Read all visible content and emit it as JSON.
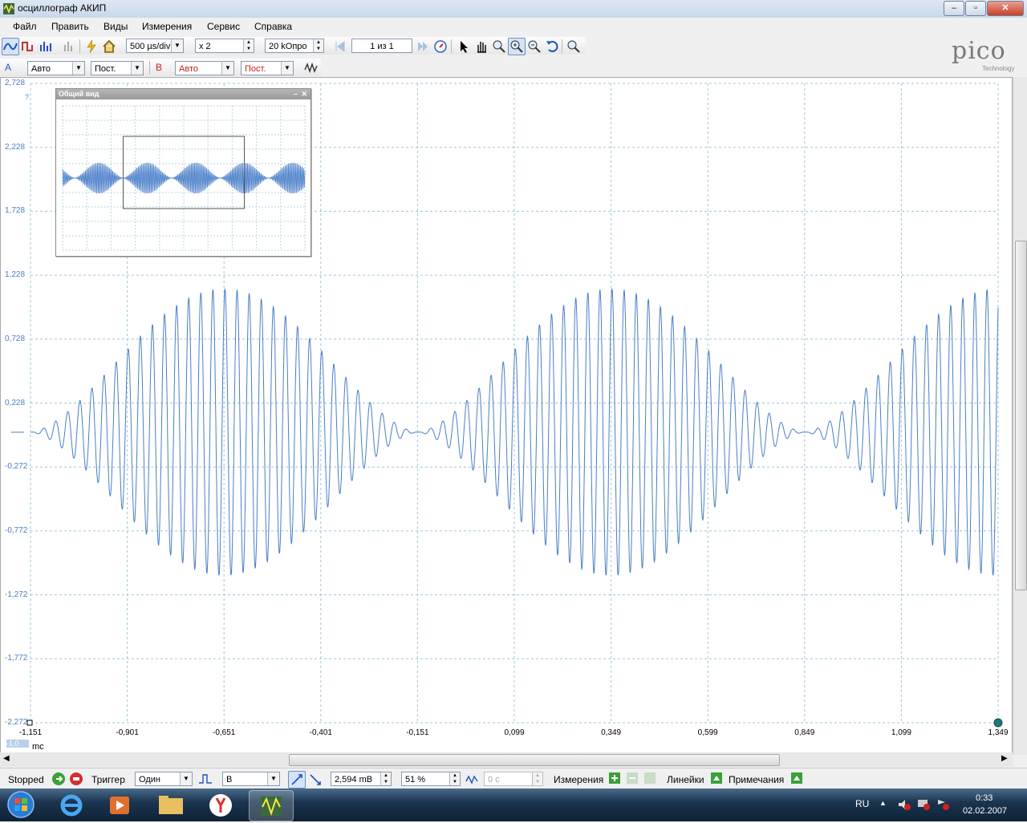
{
  "window": {
    "title": "осциллограф АКИП"
  },
  "menu": [
    "Файл",
    "Править",
    "Виды",
    "Измерения",
    "Сервис",
    "Справка"
  ],
  "toolbar": {
    "timebase": "500 µs/div",
    "zoom": "x 2",
    "samples": "20 kОпро",
    "page": "1 из 1"
  },
  "channels": {
    "a_label": "A",
    "a_range": "Авто",
    "a_coupling": "Пост.",
    "b_label": "B",
    "b_range": "Авто",
    "b_coupling": "Пост."
  },
  "logo": {
    "brand": "pico",
    "sub": "Technology"
  },
  "overview": {
    "title": "Общий вид"
  },
  "chart_data": {
    "type": "line",
    "ylabel": "",
    "xlabel": "mc",
    "y_ticks": [
      "2,728",
      "2,228",
      "1,728",
      "1,228",
      "0,728",
      "0,228",
      "-0,272",
      "-0,772",
      "-1,272",
      "-1,772",
      "-2,272"
    ],
    "x_ticks": [
      "-1,151",
      "-0,901",
      "-0,651",
      "-0,401",
      "-0,151",
      "0,099",
      "0,349",
      "0,599",
      "0,849",
      "1,099",
      "1,349"
    ],
    "xlim": [
      -1.151,
      1.349
    ],
    "ylim": [
      -2.272,
      2.728
    ],
    "grid": true,
    "series": [
      {
        "color": "#4a7ec9",
        "shape": "amplitude-modulated sine, bursts peaking near -0,65, 0,35 and 1,35 mc, peak ±1,1"
      }
    ],
    "scale_box": "-1,0",
    "y_unit_marker": "?"
  },
  "statusbar": {
    "state": "Stopped",
    "trigger_label": "Триггер",
    "trigger_mode": "Один",
    "trigger_channel": "В",
    "level": "2,594 mВ",
    "pretrigger": "51 %",
    "delay": "0 с",
    "measurements": "Измерения",
    "rulers": "Линейки",
    "notes": "Примечания"
  },
  "taskbar": {
    "lang": "RU",
    "time": "0:33",
    "date": "02.02.2007"
  }
}
